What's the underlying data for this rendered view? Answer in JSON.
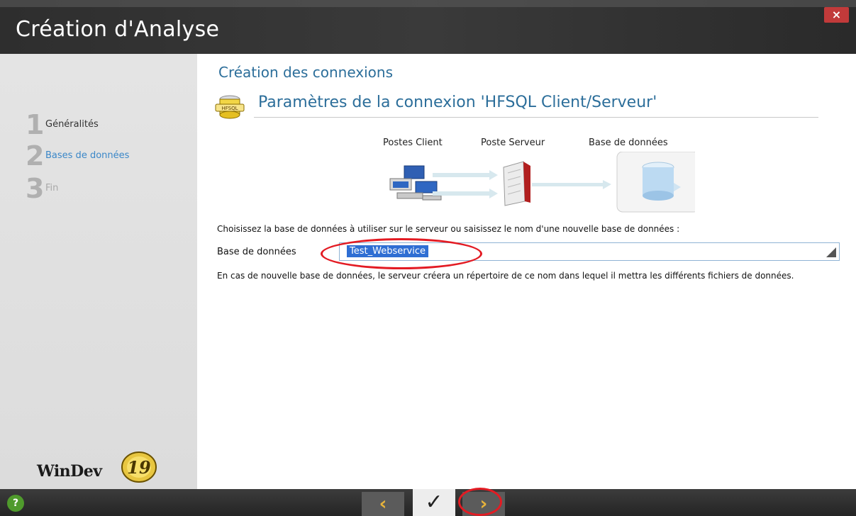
{
  "window": {
    "title": "Création d'Analyse",
    "close_label": "×"
  },
  "sidebar": {
    "steps": [
      {
        "num": "1",
        "label": "Généralités"
      },
      {
        "num": "2",
        "label": "Bases de données"
      },
      {
        "num": "3",
        "label": "Fin"
      }
    ],
    "logo_text": "WinDev",
    "logo_version": "19"
  },
  "main": {
    "section_title": "Création des connexions",
    "connection_title": "Paramètres de la connexion 'HFSQL Client/Serveur'",
    "connection_icon_text": "HFSQL",
    "diagram": {
      "client_label": "Postes Client",
      "server_label": "Poste Serveur",
      "db_label": "Base de données"
    },
    "prompt": "Choisissez la base de données à utiliser sur le serveur ou saisissez le nom d'une nouvelle base de données :",
    "field_label": "Base de données",
    "field_value": "Test_Webservice",
    "note": "En cas de nouvelle base de données, le serveur créera un répertoire de ce nom dans lequel il mettra les différents fichiers de données."
  },
  "footer": {
    "help_label": "?",
    "prev_label": "‹",
    "finish_label": "✓",
    "next_label": "›"
  },
  "colors": {
    "accent": "#2c6e9a",
    "active_step": "#3a87c8",
    "annotation": "#e31b23"
  }
}
